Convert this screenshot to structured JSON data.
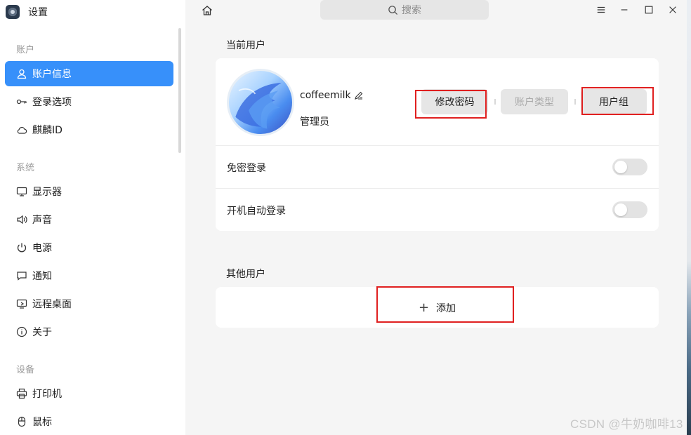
{
  "app": {
    "title": "设置"
  },
  "sidebar": {
    "groups": [
      {
        "title": "账户",
        "items": [
          {
            "label": "账户信息",
            "icon": "user-icon",
            "active": true
          },
          {
            "label": "登录选项",
            "icon": "key-icon"
          },
          {
            "label": "麒麟ID",
            "icon": "cloud-icon"
          }
        ]
      },
      {
        "title": "系统",
        "items": [
          {
            "label": "显示器",
            "icon": "monitor-icon"
          },
          {
            "label": "声音",
            "icon": "speaker-icon"
          },
          {
            "label": "电源",
            "icon": "power-icon"
          },
          {
            "label": "通知",
            "icon": "message-icon"
          },
          {
            "label": "远程桌面",
            "icon": "remote-desktop-icon"
          },
          {
            "label": "关于",
            "icon": "info-icon"
          }
        ]
      },
      {
        "title": "设备",
        "items": [
          {
            "label": "打印机",
            "icon": "printer-icon"
          },
          {
            "label": "鼠标",
            "icon": "mouse-icon"
          }
        ]
      }
    ]
  },
  "topbar": {
    "search_placeholder": "搜索"
  },
  "current_user": {
    "section_title": "当前用户",
    "username": "coffeemilk",
    "user_type": "管理员",
    "buttons": {
      "change_password": "修改密码",
      "account_type": "账户类型",
      "user_group": "用户组"
    },
    "options": [
      {
        "label": "免密登录",
        "enabled": false
      },
      {
        "label": "开机自动登录",
        "enabled": false
      }
    ]
  },
  "other_users": {
    "section_title": "其他用户",
    "add_label": "添加"
  },
  "watermark": "CSDN @牛奶咖啡13",
  "colors": {
    "accent": "#3790fa",
    "highlight_box": "#e02020"
  }
}
